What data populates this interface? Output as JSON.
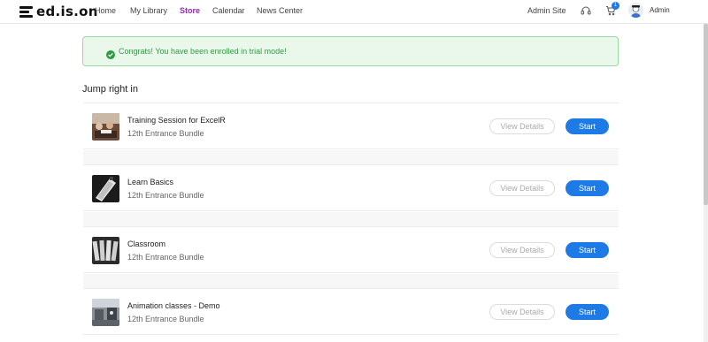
{
  "nav": {
    "logo": "ed.is.on",
    "items": [
      {
        "label": "Home",
        "active": false
      },
      {
        "label": "My Library",
        "active": false
      },
      {
        "label": "Store",
        "active": true
      },
      {
        "label": "Calendar",
        "active": false
      },
      {
        "label": "News Center",
        "active": false
      }
    ],
    "admin_site": "Admin Site",
    "cart_count": "1",
    "user_name": "Admin",
    "icons": [
      "support-icon",
      "cart-icon",
      "avatar"
    ]
  },
  "alert": {
    "text": "Congrats! You have been enrolled in trial mode!",
    "icon": "check-circle-icon",
    "color": "#2f9b42"
  },
  "section": {
    "title": "Jump right in"
  },
  "courses": [
    {
      "title": "Training Session for ExcelR",
      "subtitle": "12th Entrance Bundle",
      "details_label": "View Details",
      "start_label": "Start"
    },
    {
      "title": "Learn Basics",
      "subtitle": "12th Entrance Bundle",
      "details_label": "View Details",
      "start_label": "Start"
    },
    {
      "title": "Classroom",
      "subtitle": "12th Entrance Bundle",
      "details_label": "View Details",
      "start_label": "Start"
    },
    {
      "title": "Animation classes - Demo",
      "subtitle": "12th Entrance Bundle",
      "details_label": "View Details",
      "start_label": "Start"
    }
  ],
  "colors": {
    "accent": "#1e7be6",
    "active_nav": "#8e2fb0",
    "success": "#2f9b42"
  }
}
